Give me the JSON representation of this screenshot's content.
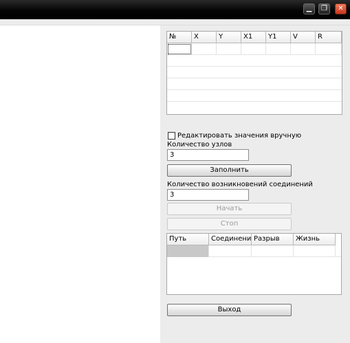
{
  "window": {
    "buttons": {
      "minimize": "▁",
      "restore": "❐",
      "close": "✕"
    },
    "colors": {
      "titlebar": "#000000",
      "panel": "#ececec",
      "close": "#d9462a"
    }
  },
  "nodes_table": {
    "columns": [
      "№",
      "X",
      "Y",
      "X1",
      "Y1",
      "V",
      "R"
    ],
    "rows": [
      [
        "",
        "",
        "",
        "",
        "",
        "",
        ""
      ]
    ]
  },
  "controls": {
    "manual_edit_label": "Редактировать значения вручную",
    "manual_edit_checked": false,
    "node_count_label": "Количество узлов",
    "node_count_value": "3",
    "fill_button": "Заполнить",
    "connections_label": "Количество возникновений соединений",
    "connections_value": "3",
    "start_button": "Начать",
    "stop_button": "Стоп",
    "exit_button": "Выход"
  },
  "paths_table": {
    "columns": [
      "Путь",
      "Соединение",
      "Разрыв",
      "Жизнь"
    ],
    "rows": [
      [
        "",
        "",
        "",
        ""
      ]
    ]
  }
}
